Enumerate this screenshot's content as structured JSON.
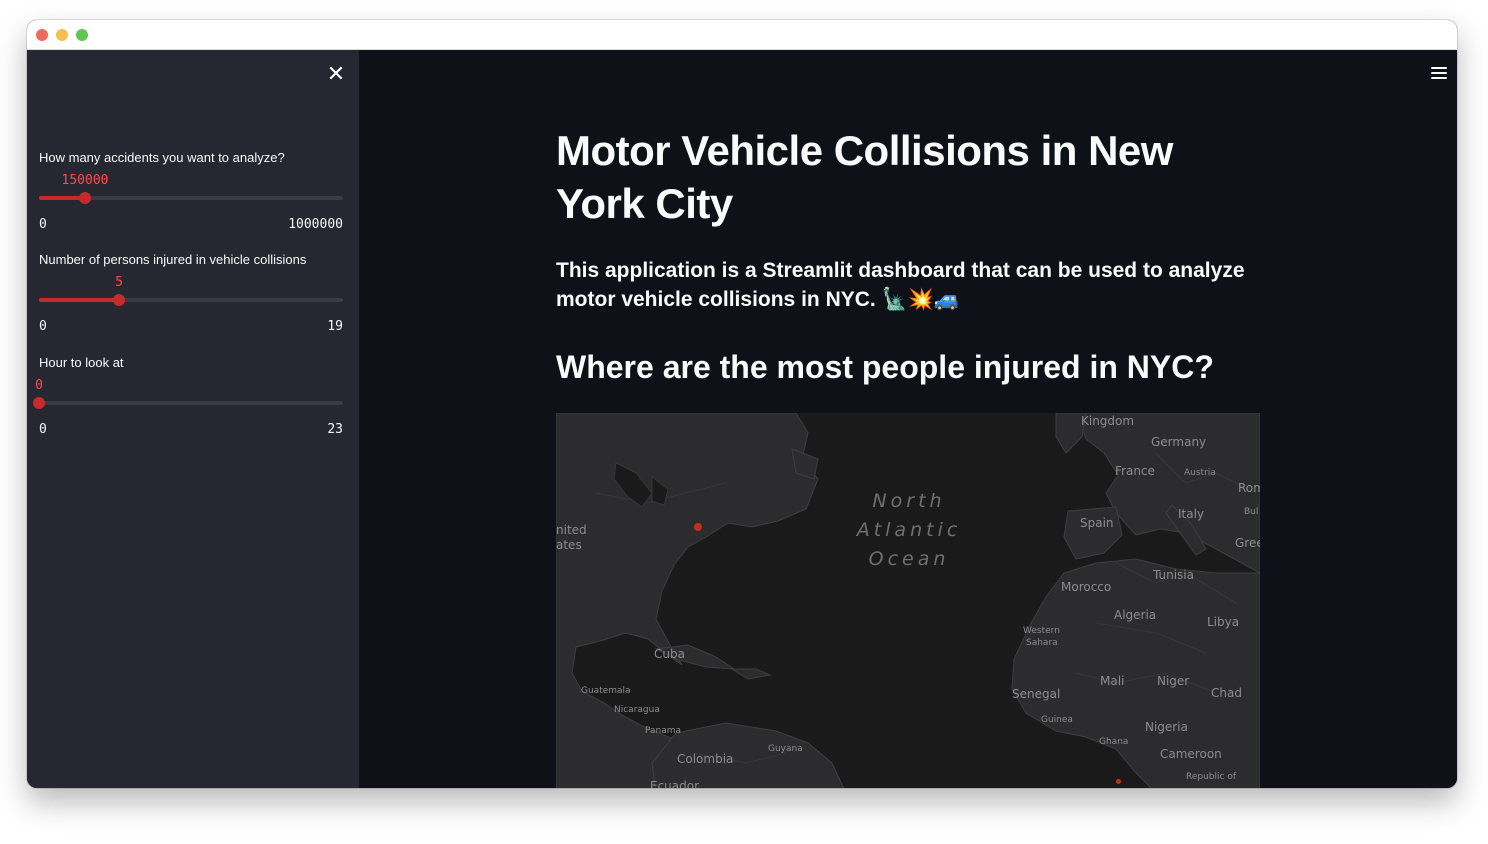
{
  "sidebar": {
    "close_icon": "close-icon",
    "sliders": [
      {
        "label": "How many accidents you want to analyze?",
        "value": "150000",
        "min": "0",
        "max": "1000000",
        "fraction": 0.15
      },
      {
        "label": "Number of persons injured in vehicle collisions",
        "value": "5",
        "min": "0",
        "max": "19",
        "fraction": 0.263
      },
      {
        "label": "Hour to look at",
        "value": "0",
        "min": "0",
        "max": "23",
        "fraction": 0.0
      }
    ]
  },
  "main": {
    "menu_icon": "hamburger-menu-icon",
    "title": "Motor Vehicle Collisions in New York City",
    "intro": "This application is a Streamlit dashboard that can be used to analyze motor vehicle collisions in NYC. 🗽💥🚙",
    "subheader": "Where are the most people injured in NYC?",
    "map": {
      "ocean_label": [
        "North",
        "Atlantic",
        "Ocean"
      ],
      "labels": {
        "kingdom": "Kingdom",
        "germany": "Germany",
        "france": "France",
        "austria": "Austria",
        "rom": "Rom",
        "bul": "Bul",
        "spain": "Spain",
        "italy": "Italy",
        "gree": "Gree",
        "united": "nited",
        "states": "ates",
        "tunisia": "Tunisia",
        "morocco": "Morocco",
        "algeria": "Algeria",
        "libya": "Libya",
        "western": "Western",
        "sahara": "Sahara",
        "cuba": "Cuba",
        "guatemala": "Guatemala",
        "nicaragua": "Nicaragua",
        "panama": "Panama",
        "guyana": "Guyana",
        "colombia": "Colombia",
        "ecuador": "Ecuador",
        "mali": "Mali",
        "niger": "Niger",
        "chad": "Chad",
        "senegal": "Senegal",
        "guinea": "Guinea",
        "nigeria": "Nigeria",
        "ghana": "Ghana",
        "cameroon": "Cameroon",
        "republic": "Republic of"
      }
    }
  }
}
